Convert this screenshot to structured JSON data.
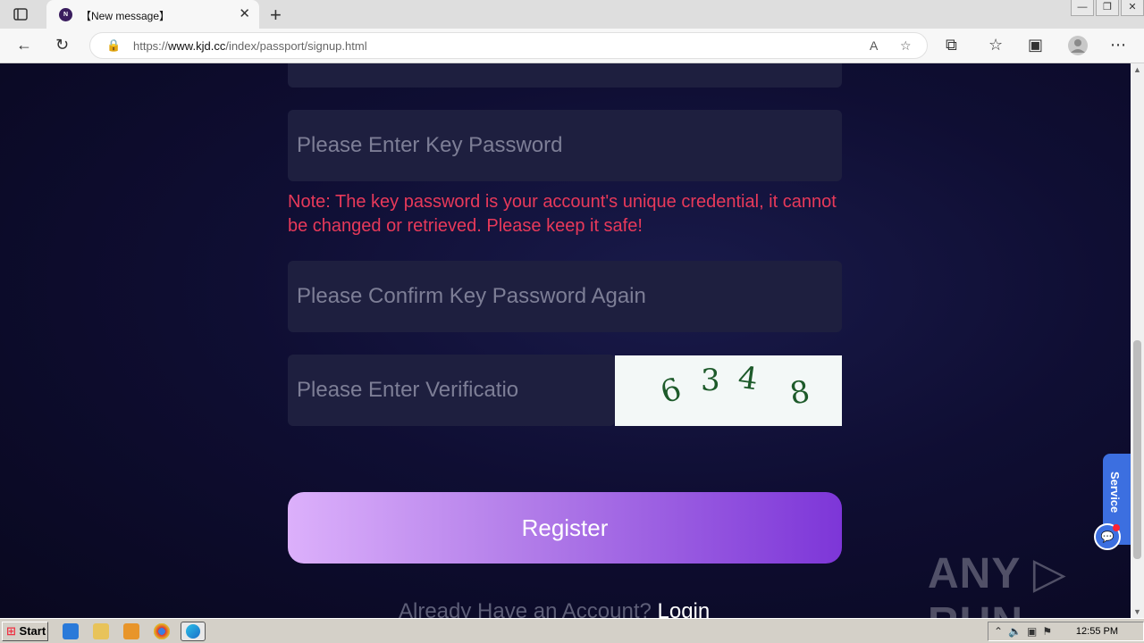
{
  "browser": {
    "tab_title": "【New message】",
    "tab_close": "✕",
    "new_tab": "+",
    "url_prefix": "https://",
    "url_domain": "www.kjd.cc",
    "url_path": "/index/passport/signup.html",
    "window_controls": [
      "—",
      "❐",
      "✕"
    ]
  },
  "form": {
    "key_password_placeholder": "Please Enter Key Password",
    "note": "Note: The key password is your account's unique credential, it cannot be changed or retrieved. Please keep it safe!",
    "confirm_password_placeholder": "Please Confirm Key Password Again",
    "verification_placeholder": "Please Enter Verificatio",
    "captcha_digits": [
      "6",
      "3",
      "4",
      "8"
    ],
    "register_label": "Register",
    "already_account": "Already Have an Account? ",
    "login_label": "Login"
  },
  "service": {
    "label": "Service"
  },
  "watermark": "ANY ▷ RUN",
  "taskbar": {
    "start_label": "Start",
    "time": "12:55 PM"
  },
  "colors": {
    "note": "#e8395a",
    "register_start": "#dcb0fb",
    "register_end": "#7d36d8",
    "field_bg": "#1e1f3f"
  }
}
